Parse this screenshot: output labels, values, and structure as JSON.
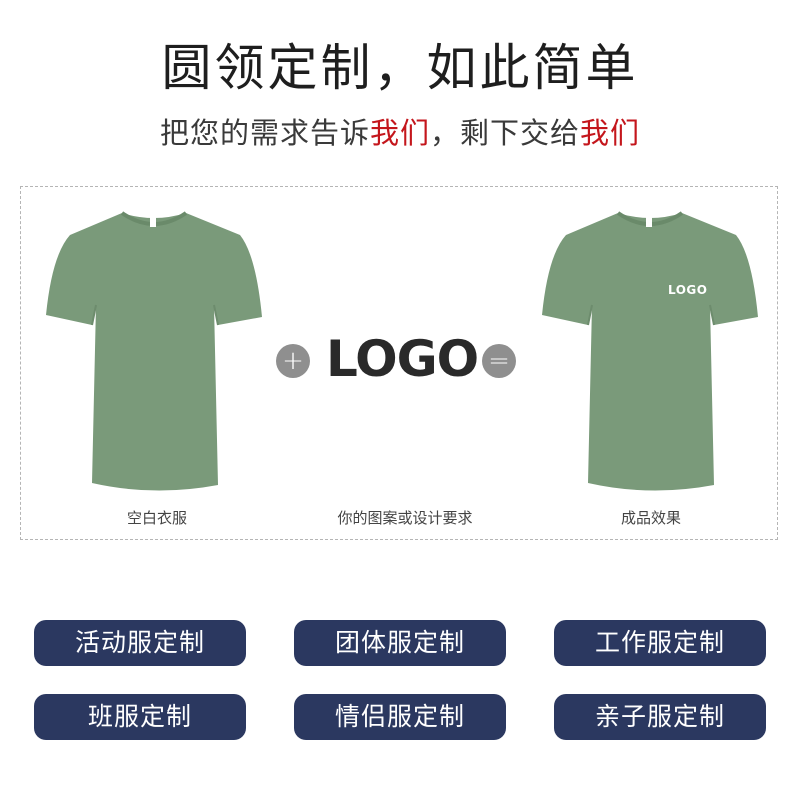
{
  "header": {
    "title": "圆领定制，如此简单",
    "subtitle_part1": "把您的需求告诉",
    "subtitle_accent1": "我们",
    "subtitle_part2": "，剩下交给",
    "subtitle_accent2": "我们",
    "accent_color": "#c4161c"
  },
  "composition": {
    "plus_symbol": "+",
    "logo_text": "LOGO",
    "equals_symbol": "=",
    "shirt_logo_text": "LOGO",
    "shirt_color": "#7a9a7a",
    "captions": {
      "blank": "空白衣服",
      "design": "你的图案或设计要求",
      "result": "成品效果"
    }
  },
  "categories": [
    {
      "label": "活动服定制"
    },
    {
      "label": "团体服定制"
    },
    {
      "label": "工作服定制"
    },
    {
      "label": "班服定制"
    },
    {
      "label": "情侣服定制"
    },
    {
      "label": "亲子服定制"
    }
  ],
  "button_color": "#2b3860"
}
